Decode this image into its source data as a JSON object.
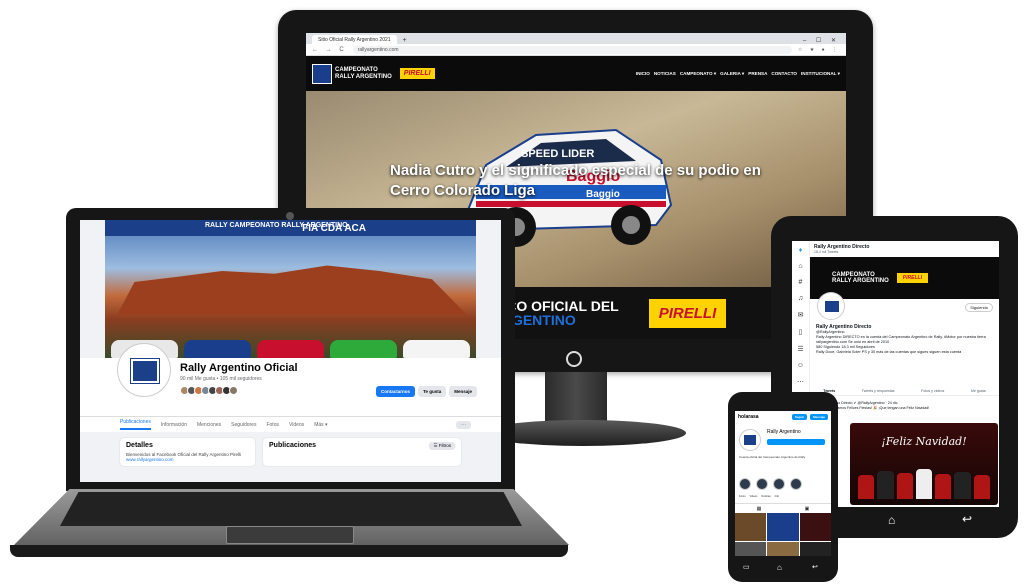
{
  "monitor": {
    "browser": {
      "tab_title": "Sitio Oficial Rally Argentino 2021",
      "new_tab": "+",
      "window_controls": "– ☐ ✕",
      "nav_icons": "← → C",
      "url": "rallyargentino.com",
      "ext_icons": "☆ ★ ● ⋮"
    },
    "site": {
      "logo_text": "CAMPEONATO\nRALLY ARGENTINO",
      "sponsor": "PIRELLI",
      "nav": [
        "INICIO",
        "NOTICIAS",
        "CAMPEONATO ▾",
        "GALERIA ▾",
        "PRENSA",
        "CONTACTO",
        "INSTITUCIONAL ▾"
      ],
      "hero_title": "Nadia Cutro y el significado especial de su podio en Cerro Colorado Liga",
      "banner_line1": "MÁTICO OFICIAL DEL",
      "banner_line2": "LY ARGENTINO",
      "banner_sponsor": "PIRELLI",
      "car_livery": [
        "SPEED LIDER",
        "Baggio",
        "Baggio"
      ]
    }
  },
  "laptop": {
    "facebook": {
      "cover_title": "RALLY  CAMPEONATO RALLY ARGENTINO",
      "cover_logos": "FIA  CDA  ACA",
      "page_name": "Rally Argentino Oficial",
      "stats": "90 mil Me gusta • 105 mil seguidores",
      "buttons": [
        "Contactarnos",
        "Te gusta",
        "Mensaje"
      ],
      "tabs": [
        "Publicaciones",
        "Información",
        "Menciones",
        "Seguidores",
        "Fotos",
        "Videos",
        "Más ▾"
      ],
      "more_button": "···",
      "details_heading": "Detalles",
      "details_text": "Bienvenidos al Facebook Oficial del Rally Argentino Pirelli",
      "details_link": "www.rallyargentino.com",
      "posts_heading": "Publicaciones",
      "filter_button": "☰ Filtros"
    }
  },
  "tablet": {
    "twitter": {
      "sidebar_icons": [
        "twitter-bird",
        "home",
        "explore",
        "notifications",
        "messages",
        "bookmarks",
        "lists",
        "profile",
        "more"
      ],
      "top_name": "Rally Argentino Directo",
      "top_count": "18,4 mil Tweets",
      "banner_text": "CAMPEONATO\nRALLY ARGENTINO",
      "banner_sponsor": "PIRELLI",
      "follow_button": "Siguiendo",
      "profile_name": "Rally Argentino Directo",
      "handle": "@RallyArgentino",
      "bio": "Rally Argentino DIRECTO en la cuenta del Campeonato Argentino de Rally. #Motor por nuestra tierra",
      "joined": "rallyargentino.com   Se unió en abril de 2010",
      "following": "580 Siguiendo    18,3 mil Seguidores",
      "followed_by": "Rally Doce, Gabriela Soler PS y 30 más de las cuentas que sigues siguen esta cuenta",
      "tabs": [
        "Tweets",
        "Tweets y respuestas",
        "Fotos y videos",
        "Me gusta"
      ],
      "tweet_author": "Rally Argentino Directo ✔ @RallyArgentino · 24 dic.",
      "tweet_text": "🎄 ¡Les deseamos Felices Fiestas! 🎉 ¡Que tengan una Feliz Navidad!",
      "image_text": "¡Feliz Navidad!"
    }
  },
  "phone": {
    "instagram": {
      "username": "holarasa",
      "follow_button": "Seguir",
      "message_button": "Mensaje",
      "profile_name": "Rally Argentino",
      "bio": "Cuenta oficial del Campeonato Argentino de Rally",
      "highlights": [
        "Fotos",
        "Videos",
        "Noticias",
        "Info"
      ],
      "nav": [
        "⌂",
        "⌕",
        "▶",
        "♡",
        "●"
      ],
      "tabs": [
        "▦",
        "▣"
      ]
    },
    "buttons": [
      "▭",
      "⌂",
      "↩"
    ]
  },
  "tablet_buttons": [
    "⌂",
    "↩"
  ]
}
